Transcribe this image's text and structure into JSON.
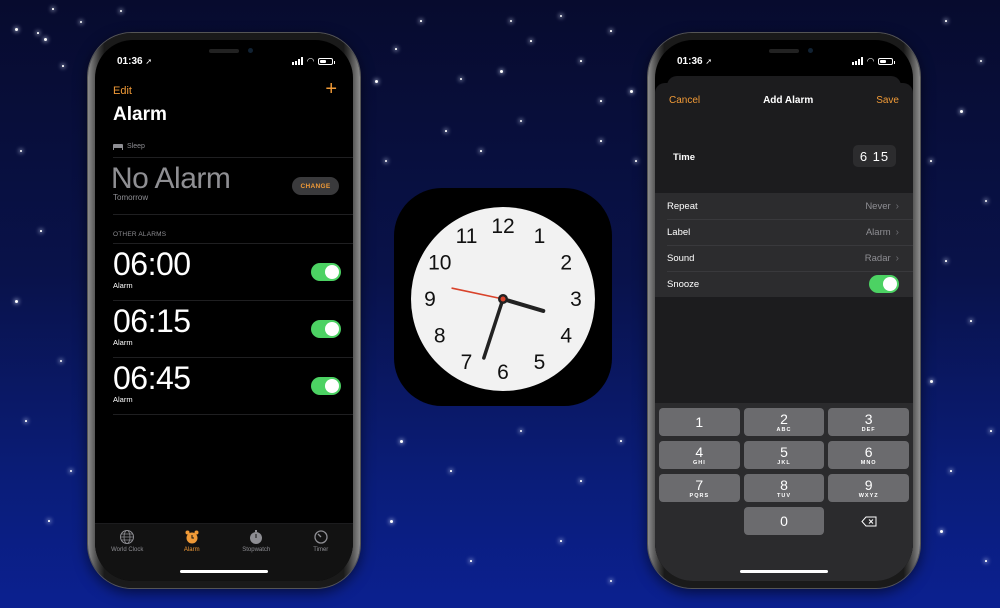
{
  "status_bar": {
    "time": "01:36"
  },
  "alarm_screen": {
    "edit_label": "Edit",
    "add_label": "+",
    "title": "Alarm",
    "sleep_header": "Sleep",
    "sleep_value": "No Alarm",
    "sleep_sub": "Tomorrow",
    "change_label": "CHANGE",
    "other_header": "OTHER ALARMS",
    "alarms": [
      {
        "time": "06:00",
        "label": "Alarm",
        "enabled": true
      },
      {
        "time": "06:15",
        "label": "Alarm",
        "enabled": true
      },
      {
        "time": "06:45",
        "label": "Alarm",
        "enabled": true
      }
    ],
    "tabs": [
      {
        "label": "World Clock",
        "icon": "globe-icon",
        "active": false
      },
      {
        "label": "Alarm",
        "icon": "alarm-clock-icon",
        "active": true
      },
      {
        "label": "Stopwatch",
        "icon": "stopwatch-icon",
        "active": false
      },
      {
        "label": "Timer",
        "icon": "timer-icon",
        "active": false
      }
    ]
  },
  "add_alarm_screen": {
    "cancel_label": "Cancel",
    "title": "Add Alarm",
    "save_label": "Save",
    "time_label": "Time",
    "time_value": "6 15",
    "settings": [
      {
        "label": "Repeat",
        "value": "Never"
      },
      {
        "label": "Label",
        "value": "Alarm"
      },
      {
        "label": "Sound",
        "value": "Radar"
      },
      {
        "label": "Snooze",
        "toggle": true
      }
    ],
    "keypad": [
      {
        "n": "1",
        "l": ""
      },
      {
        "n": "2",
        "l": "ABC"
      },
      {
        "n": "3",
        "l": "DEF"
      },
      {
        "n": "4",
        "l": "GHI"
      },
      {
        "n": "5",
        "l": "JKL"
      },
      {
        "n": "6",
        "l": "MNO"
      },
      {
        "n": "7",
        "l": "PQRS"
      },
      {
        "n": "8",
        "l": "TUV"
      },
      {
        "n": "9",
        "l": "WXYZ"
      },
      {
        "n": "0",
        "l": ""
      }
    ]
  },
  "clock_icon": {
    "numerals": [
      "12",
      "1",
      "2",
      "3",
      "4",
      "5",
      "6",
      "7",
      "8",
      "9",
      "10",
      "11"
    ],
    "hour": 3,
    "minute": 33,
    "second": 47
  },
  "colors": {
    "accent": "#f09a37",
    "toggle_on": "#4cd263",
    "second_hand": "#d9432b"
  }
}
